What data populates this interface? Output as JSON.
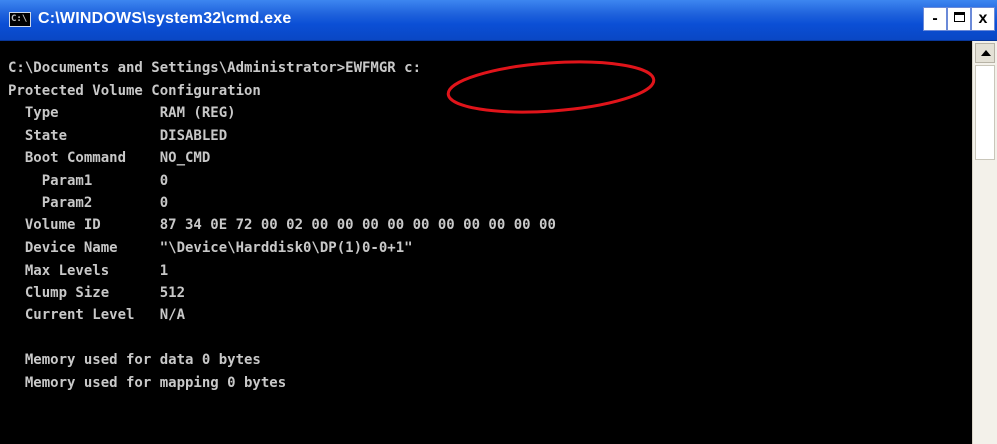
{
  "window": {
    "title": "C:\\WINDOWS\\system32\\cmd.exe",
    "icon_text": "C:\\",
    "controls": {
      "minimize": "-",
      "close": "x"
    }
  },
  "console": {
    "lines": [
      "",
      "C:\\Documents and Settings\\Administrator>EWFMGR c:",
      "Protected Volume Configuration",
      "  Type            RAM (REG)",
      "  State           DISABLED",
      "  Boot Command    NO_CMD",
      "    Param1        0",
      "    Param2        0",
      "  Volume ID       87 34 0E 72 00 02 00 00 00 00 00 00 00 00 00 00",
      "  Device Name     \"\\Device\\Harddisk0\\DP(1)0-0+1\"",
      "  Max Levels      1",
      "  Clump Size      512",
      "  Current Level   N/A",
      "",
      "  Memory used for data 0 bytes",
      "  Memory used for mapping 0 bytes"
    ]
  },
  "colors": {
    "titlebar": "#0b4fd6",
    "console_bg": "#000000",
    "console_text": "#c8c8c8",
    "annotation": "#e0141a"
  }
}
